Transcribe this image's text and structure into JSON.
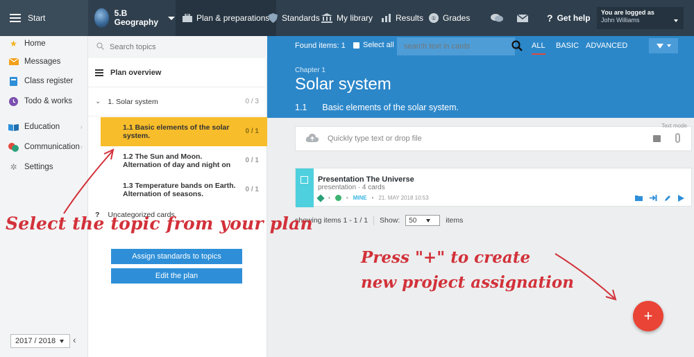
{
  "topbar": {
    "start_label": "Start",
    "class_line1": "5.B",
    "class_line2": "Geography",
    "nav": [
      {
        "label": "Plan & preparations",
        "icon": "briefcase-icon"
      },
      {
        "label": "Standards",
        "icon": "shield-icon"
      },
      {
        "label": "My library",
        "icon": "library-icon"
      },
      {
        "label": "Results",
        "icon": "bar-chart-icon"
      },
      {
        "label": "Grades",
        "icon": "grades-icon"
      }
    ],
    "help_label": "Get help",
    "login_line1": "You are logged as",
    "login_user": "John Williams"
  },
  "leftnav": {
    "items": [
      {
        "label": "Home",
        "icon": "star-icon",
        "color": "#f3b21b"
      },
      {
        "label": "Messages",
        "icon": "envelope-icon",
        "color": "#f3a01b"
      },
      {
        "label": "Class register",
        "icon": "register-icon",
        "color": "#2e8fd8"
      },
      {
        "label": "Todo & works",
        "icon": "clock-icon",
        "color": "#7b4fb0"
      },
      {
        "label": "Education",
        "icon": "book-icon",
        "color": "#2e8fd8"
      },
      {
        "label": "Communication",
        "icon": "chat-icon",
        "color": "#e34a3b"
      },
      {
        "label": "Settings",
        "icon": "gear-icon",
        "color": "#888888"
      }
    ],
    "school_year": "2017 / 2018"
  },
  "topics": {
    "search_placeholder": "Search topics",
    "plan_overview": "Plan overview",
    "chapter": {
      "label": "1. Solar system",
      "count": "0 / 3"
    },
    "subtopics": [
      {
        "label": "1.1  Basic elements of the solar system.",
        "count": "0 / 1",
        "selected": true
      },
      {
        "label": "1.2  The Sun and Moon. Alternation of day and night on",
        "count": "0 / 1",
        "selected": false
      },
      {
        "label": "1.3  Temperature bands on Earth. Alternation of seasons.",
        "count": "0 / 1",
        "selected": false
      }
    ],
    "uncategorized": "Uncategorized cards",
    "btn_assign": "Assign standards to topics",
    "btn_edit": "Edit the plan"
  },
  "main": {
    "found_items": "Found items: 1",
    "select_all": "Select all",
    "search_placeholder": "search text in cards",
    "levels": [
      "ALL",
      "BASIC",
      "ADVANCED"
    ],
    "chapter_label": "Chapter 1",
    "chapter_title": "Solar system",
    "section_num": "1.1",
    "section_title": "Basic elements of the solar system.",
    "quick_placeholder": "Quickly type text or drop file",
    "text_mode": "Text mode",
    "card": {
      "title": "Presentation The Universe",
      "subtitle": "presentation · 4 cards",
      "owner": "MINE",
      "date": "21. MAY 2018 10:53"
    },
    "paging_text": "showing items 1 - 1 / 1",
    "show_label": "Show:",
    "show_value": "50",
    "items_label": "items",
    "fab_label": "+"
  },
  "annotations": {
    "select_topic": "Select the topic from your plan",
    "press_plus_1": "Press \"+\" to create",
    "press_plus_2": "new project assignation"
  },
  "colors": {
    "topbar": "#2f3f4d",
    "accent_blue": "#2c87c9",
    "selected_topic": "#f7bd2b",
    "fab": "#e94435",
    "annotation": "#d2313a"
  }
}
